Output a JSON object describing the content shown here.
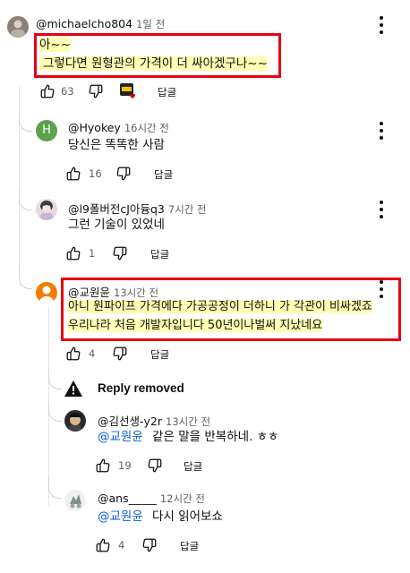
{
  "comments": [
    {
      "author": "@michaelcho804",
      "time": "1일 전",
      "lines": [
        "아~~",
        "그렇다면 원형관의 가격이 더 싸아겠구나~~"
      ],
      "likes": "63",
      "reply_label": "답글"
    },
    {
      "author": "@Hyokey",
      "time": "16시간 전",
      "avatar_letter": "H",
      "lines": [
        "당신은 똑똑한 사람"
      ],
      "likes": "16",
      "reply_label": "답글"
    },
    {
      "author": "@l9폴버전cJ아듕q3",
      "time": "7시간 전",
      "lines": [
        "그런 기술이 있었네"
      ],
      "likes": "1",
      "reply_label": "답글"
    },
    {
      "author": "@교원윤",
      "time": "13시간 전",
      "lines": [
        "아니 원파이프  가격에다  가공공정이 더하니 가 각관이 비싸겠죠",
        "우리나라 처음 개발자입니다  50년이나벌써 지났네요"
      ],
      "likes": "4",
      "reply_label": "답글"
    },
    {
      "author": "@김선생-y2r",
      "time": "13시간 전",
      "mention": "@교원윤",
      "text": " 같은 말을 반복하네. ㅎㅎ",
      "likes": "19",
      "reply_label": "답글"
    },
    {
      "author": "@ans_____",
      "time": "12시간 전",
      "mention": "@교원윤",
      "text": " 다시 읽어보쇼",
      "likes": "4",
      "reply_label": "답글"
    }
  ],
  "removed_notice": "Reply removed",
  "colors": {
    "highlight_box": "#e60012",
    "highlight_bg": "#ffffb3",
    "mention": "#065fd4",
    "hyokey_avatar": "#5aa34a",
    "orange_avatar": "#f57c00"
  }
}
